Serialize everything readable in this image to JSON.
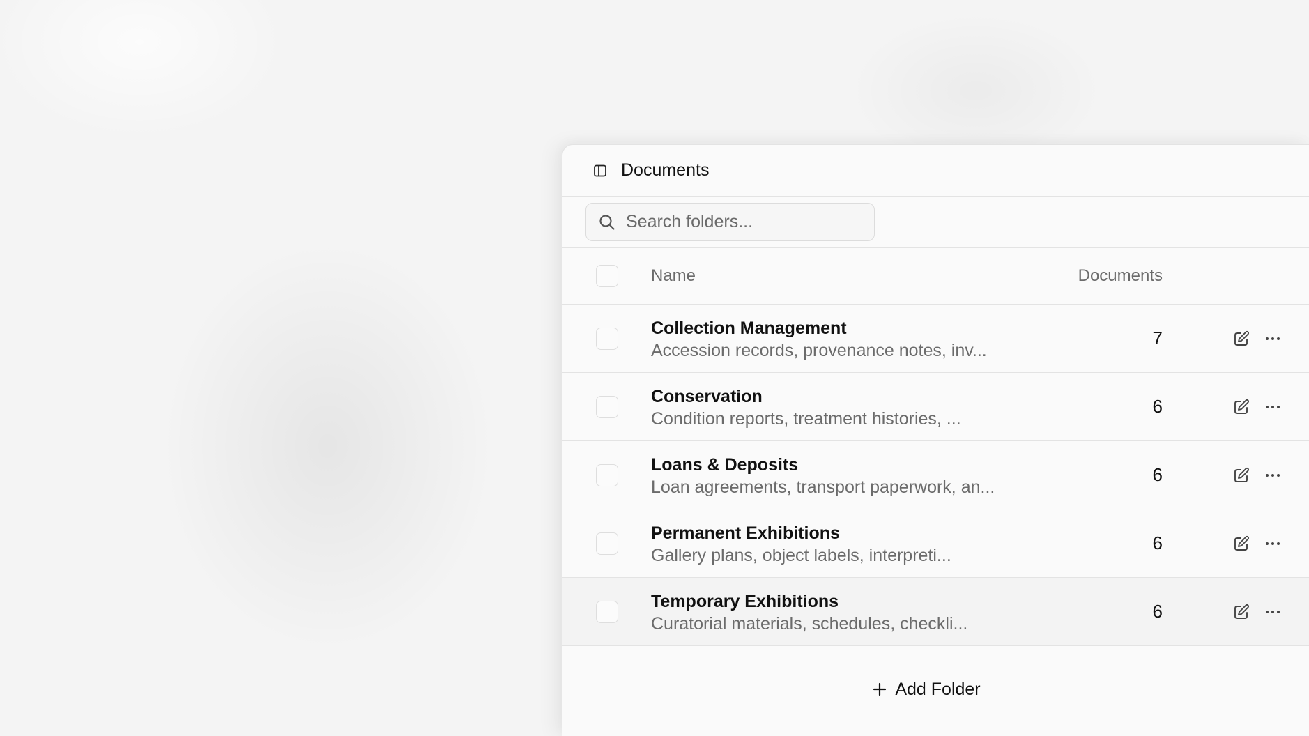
{
  "header": {
    "title": "Documents",
    "icon": "sidebar-panel-icon"
  },
  "search": {
    "placeholder": "Search folders...",
    "icon": "search-icon"
  },
  "table": {
    "columns": {
      "name": "Name",
      "documents": "Documents"
    },
    "rows": [
      {
        "name": "Collection Management",
        "description": "Accession records, provenance notes, inv...",
        "count": "7"
      },
      {
        "name": "Conservation",
        "description": "Condition reports, treatment histories, ...",
        "count": "6"
      },
      {
        "name": "Loans & Deposits",
        "description": "Loan agreements, transport paperwork, an...",
        "count": "6"
      },
      {
        "name": "Permanent Exhibitions",
        "description": "Gallery plans, object labels, interpreti...",
        "count": "6"
      },
      {
        "name": "Temporary Exhibitions",
        "description": "Curatorial materials, schedules, checkli...",
        "count": "6"
      }
    ]
  },
  "footer": {
    "add_label": "Add Folder",
    "icon": "plus-icon"
  },
  "colors": {
    "panel": "#fafafa",
    "border": "#e3e3e3",
    "muted_text": "#6b6b6b",
    "text": "#111111"
  }
}
